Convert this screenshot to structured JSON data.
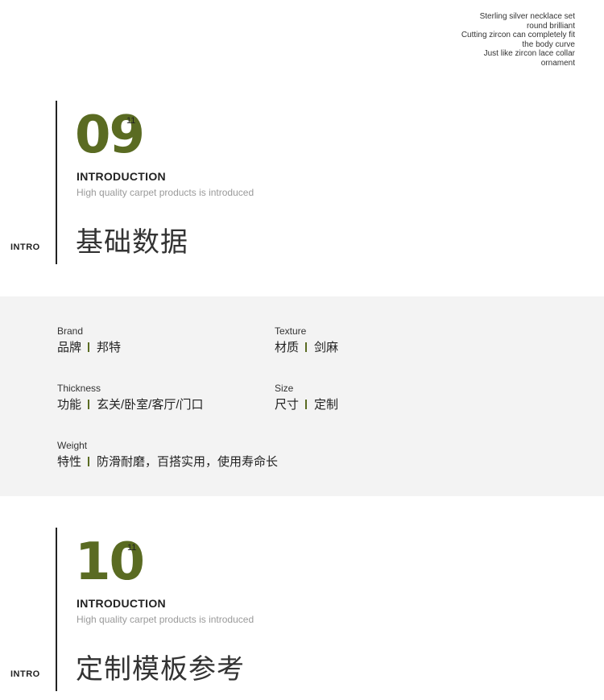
{
  "tagline": [
    "Sterling silver necklace set",
    "round brilliant",
    "Cutting zircon can completely fit",
    "the body curve",
    "Just like zircon lace collar",
    "ornament"
  ],
  "sections": [
    {
      "number": "09",
      "sup": "11",
      "intro_title": "INTRODUCTION",
      "intro_sub": "High quality carpet products is introduced",
      "side_label": "INTRO",
      "heading": "基础数据"
    },
    {
      "number": "10",
      "sup": "11",
      "intro_title": "INTRODUCTION",
      "intro_sub": "High quality carpet products is introduced",
      "side_label": "INTRO",
      "heading": "定制模板参考"
    }
  ],
  "specs": [
    {
      "label": "Brand",
      "key": "品牌",
      "value": "邦特"
    },
    {
      "label": "Texture",
      "key": "材质",
      "value": "剑麻"
    },
    {
      "label": "Thickness",
      "key": "功能",
      "value": "玄关/卧室/客厅/门口"
    },
    {
      "label": "Size",
      "key": "尺寸",
      "value": "定制"
    },
    {
      "label": "Weight",
      "key": "特性",
      "value": "防滑耐磨，百搭实用，使用寿命长"
    }
  ],
  "colors": {
    "accent": "#5a6b22",
    "band": "#f3f3f3"
  }
}
